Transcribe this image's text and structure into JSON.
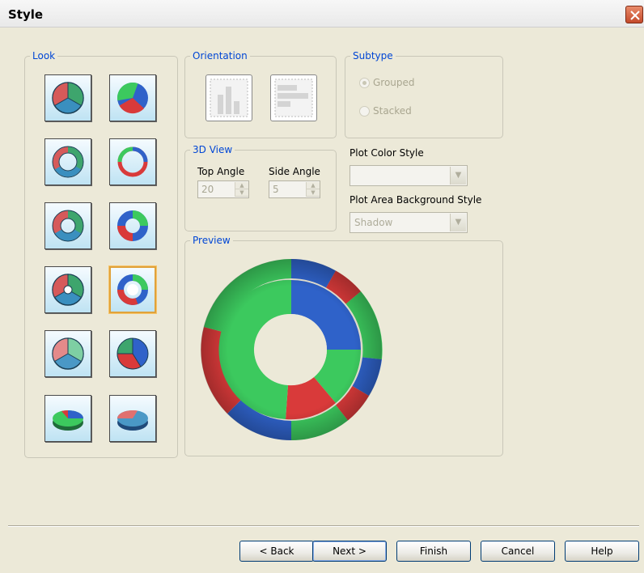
{
  "window": {
    "title": "Style"
  },
  "look": {
    "legend": "Look",
    "items": [
      {
        "name": "pie-flat"
      },
      {
        "name": "pie-shaded"
      },
      {
        "name": "ring-flat"
      },
      {
        "name": "ring-shaded"
      },
      {
        "name": "doughnut-flat"
      },
      {
        "name": "doughnut-shaded"
      },
      {
        "name": "pie-hole-flat"
      },
      {
        "name": "doughnut-multi-shaded",
        "selected": true
      },
      {
        "name": "pie-flat-2"
      },
      {
        "name": "pie-shaded-2"
      },
      {
        "name": "pie-3d"
      },
      {
        "name": "pie-3d-2"
      }
    ]
  },
  "orientation": {
    "legend": "Orientation",
    "vertical": "vertical-bars-icon",
    "horizontal": "horizontal-bars-icon"
  },
  "subtype": {
    "legend": "Subtype",
    "grouped": "Grouped",
    "stacked": "Stacked",
    "selected": "Grouped"
  },
  "view3d": {
    "legend": "3D View",
    "top_angle_label": "Top Angle",
    "top_angle_value": "20",
    "side_angle_label": "Side Angle",
    "side_angle_value": "5"
  },
  "plot_color": {
    "label": "Plot Color Style",
    "value": ""
  },
  "plot_area": {
    "label": "Plot Area Background Style",
    "value": "Shadow"
  },
  "preview": {
    "legend": "Preview"
  },
  "colors": {
    "green": "#3cc95e",
    "blue": "#2f62c9",
    "red": "#d93a3a",
    "accent": "#0046d5"
  },
  "buttons": {
    "back": "< Back",
    "next": "Next >",
    "finish": "Finish",
    "cancel": "Cancel",
    "help": "Help"
  }
}
